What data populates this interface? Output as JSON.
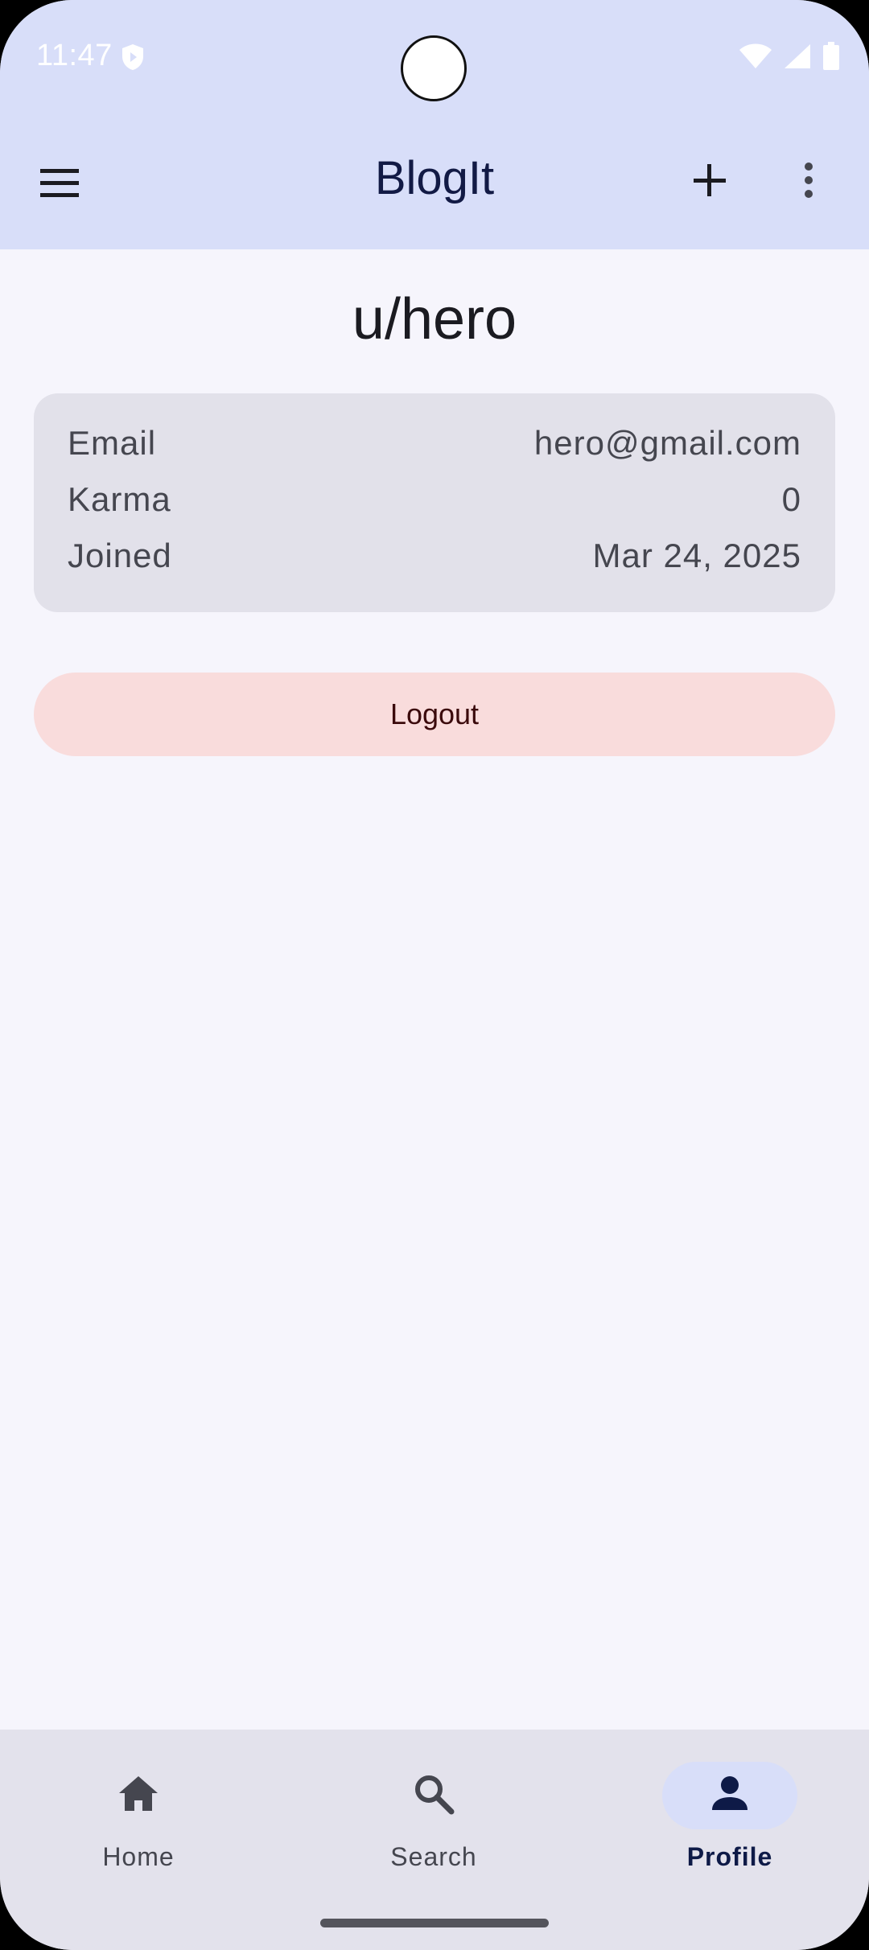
{
  "status_bar": {
    "time": "11:47"
  },
  "app_bar": {
    "title": "BlogIt"
  },
  "profile": {
    "username": "u/hero",
    "rows": [
      {
        "label": "Email",
        "value": "hero@gmail.com"
      },
      {
        "label": "Karma",
        "value": "0"
      },
      {
        "label": "Joined",
        "value": "Mar 24, 2025"
      }
    ],
    "logout_label": "Logout"
  },
  "bottom_nav": {
    "items": [
      {
        "label": "Home",
        "icon": "home-icon",
        "active": false
      },
      {
        "label": "Search",
        "icon": "search-icon",
        "active": false
      },
      {
        "label": "Profile",
        "icon": "person-icon",
        "active": true
      }
    ]
  },
  "colors": {
    "top_bar": "#d8def9",
    "background": "#f6f5fc",
    "card": "#e2e1ea",
    "logout_button": "#f9dcdc",
    "nav_active_pill": "#d8def9"
  }
}
